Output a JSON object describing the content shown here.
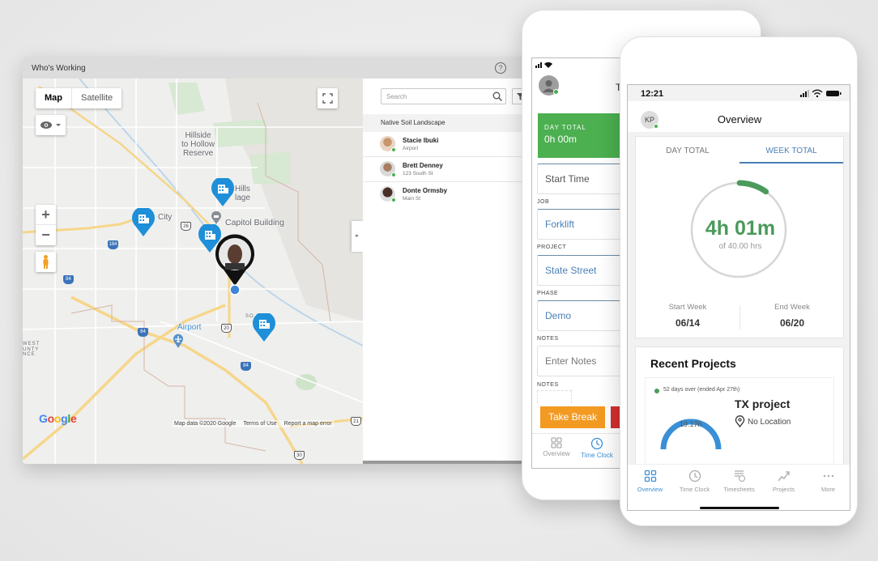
{
  "window": {
    "title": "Who's Working",
    "help_icon": "?"
  },
  "map": {
    "type_options": [
      "Map",
      "Satellite"
    ],
    "selected_type": "Map",
    "zoom_in": "+",
    "zoom_out": "−",
    "labels": {
      "hillside": "Hillside\nto Hollow\nReserve",
      "hills": "Hills\nlage",
      "city": "City",
      "capitol": "Capitol Building",
      "airport": "Airport",
      "west": "WEST\nUNTY\nNCE",
      "southeast": "SO    ST"
    },
    "shields": [
      "184",
      "26",
      "84",
      "84",
      "20",
      "84",
      "30",
      "21"
    ],
    "google_logo": [
      "G",
      "o",
      "o",
      "g",
      "l",
      "e"
    ],
    "google_colors": [
      "#4285f4",
      "#ea4335",
      "#fbbc05",
      "#4285f4",
      "#34a853",
      "#ea4335"
    ],
    "attribution": {
      "data": "Map data ©2020 Google",
      "terms": "Terms of Use",
      "report": "Report a map error"
    },
    "collapse_icon": "▸",
    "marker_color": "#1e8fd8"
  },
  "sidebar": {
    "search_placeholder": "Search",
    "group": "Native Soil Landscape",
    "employees": [
      {
        "name": "Stacie Ibuki",
        "location": "Airport",
        "status": "online"
      },
      {
        "name": "Brett Denney",
        "location": "123 South St",
        "status": "online"
      },
      {
        "name": "Donte Ormsby",
        "location": "Main St",
        "status": "online"
      }
    ]
  },
  "phone1": {
    "title_partial": "T",
    "day_total_label": "DAY TOTAL",
    "day_total_value": "0h 00m",
    "start_time": "Start Time",
    "fields": [
      {
        "label": "JOB",
        "value": "Forklift"
      },
      {
        "label": "PROJECT",
        "value": "State Street"
      },
      {
        "label": "PHASE",
        "value": "Demo"
      },
      {
        "label": "NOTES",
        "value": "Enter Notes"
      }
    ],
    "notes_label_2": "NOTES",
    "take_break": "Take Break",
    "tabs": [
      {
        "label": "Overview",
        "active": false
      },
      {
        "label": "Time Clock",
        "active": true
      }
    ],
    "colors": {
      "day_total": "#4caf50",
      "take_break": "#f39a22",
      "clock_out": "#d32f2f"
    }
  },
  "phone2": {
    "status_time": "12:21",
    "user_initials": "KP",
    "title": "Overview",
    "tabs": [
      {
        "label": "DAY TOTAL",
        "active": false
      },
      {
        "label": "WEEK TOTAL",
        "active": true
      }
    ],
    "week_hours": "4h 01m",
    "week_goal": "of 40.00 hrs",
    "week_progress_fraction": 0.1,
    "start_week_label": "Start Week",
    "start_week": "06/14",
    "end_week_label": "End Week",
    "end_week": "06/20",
    "recent_projects_title": "Recent Projects",
    "project": {
      "status": "52 days over (ended Apr 27th)",
      "name": "TX  project",
      "location": "No Location",
      "hours": "19.17h"
    },
    "bottom_tabs": [
      {
        "label": "Overview",
        "active": true
      },
      {
        "label": "Time Clock",
        "active": false
      },
      {
        "label": "Timesheets",
        "active": false
      },
      {
        "label": "Projects",
        "active": false
      },
      {
        "label": "More",
        "active": false
      }
    ],
    "colors": {
      "accent": "#4a7fb5",
      "progress": "#4b9a5c",
      "project_arc": "#3a8fd6"
    }
  }
}
